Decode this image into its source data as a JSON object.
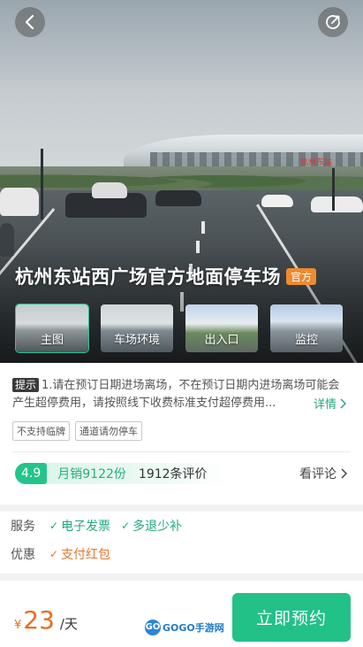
{
  "header": {
    "back_icon": "back-arrow-icon",
    "share_icon": "share-icon"
  },
  "hero": {
    "title": "杭州东站西广场官方地面停车场",
    "badge": "官方",
    "station_sign": "杭州东站",
    "thumbs": [
      {
        "label": "主图",
        "active": true
      },
      {
        "label": "车场环境",
        "active": false
      },
      {
        "label": "出入口",
        "active": false
      },
      {
        "label": "监控",
        "active": false
      }
    ]
  },
  "notice": {
    "tip_label": "提示",
    "text": "1.请在预订日期进场离场，不在预订日期内进场离场可能会产生超停费用，请按照线下收费标准支付超停费用...",
    "detail_label": "详情"
  },
  "tags": [
    "不支持临牌",
    "通道请勿停车"
  ],
  "rating": {
    "score": "4.9",
    "sales": "月销9122份",
    "reviews": "1912条评价",
    "see_reviews": "看评论"
  },
  "services": {
    "service_label": "服务",
    "service_items": [
      "电子发票",
      "多退少补"
    ],
    "discount_label": "优惠",
    "discount_items": [
      "支付红包"
    ]
  },
  "footer": {
    "currency": "¥",
    "price": "23",
    "unit": "/天",
    "watermark_ball": "GO",
    "watermark_text": "GOGO手游网",
    "book_label": "立即预约"
  },
  "colors": {
    "accent_green": "#22c187",
    "price_orange": "#ee6a1d",
    "badge_orange": "#ee8a2f"
  }
}
